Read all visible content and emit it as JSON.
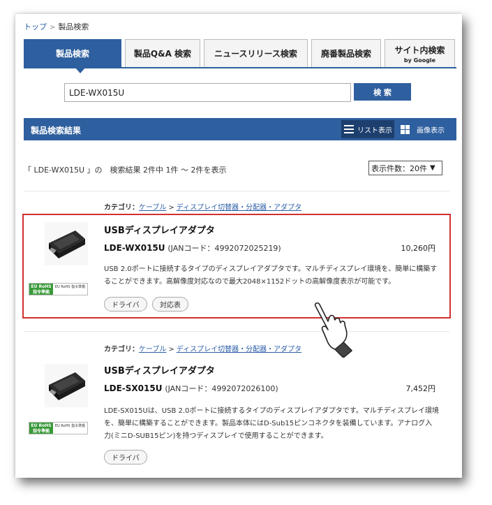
{
  "breadcrumb": {
    "home": "トップ",
    "separator": ">",
    "current": "製品検索"
  },
  "tabs": [
    {
      "label": "製品検索",
      "sub": "",
      "active": true
    },
    {
      "label": "製品Q&A 検索",
      "sub": ""
    },
    {
      "label": "ニュースリリース検索",
      "sub": ""
    },
    {
      "label": "廃番製品検索",
      "sub": ""
    },
    {
      "label": "サイト内検索",
      "sub": "by Google"
    }
  ],
  "search": {
    "value": "LDE-WX015U",
    "button": "検 索"
  },
  "results": {
    "title": "製品検索結果",
    "view_list": "リスト表示",
    "view_image": "画像表示",
    "summary": "「 LDE-WX015U 」の　検索結果 2件中 1件 ～ 2件を表示",
    "per_page": "表示件数：20件"
  },
  "products": [
    {
      "category_label": "カテゴリ：",
      "category_1": "ケーブル",
      "category_sep": ">",
      "category_2": "ディスプレイ切替器・分配器・アダプタ",
      "name": "USBディスプレイアダプタ",
      "model": "LDE-WX015U",
      "jan": "(JANコード：4992072025219)",
      "price": "10,260円",
      "desc": "USB 2.0ポートに接続するタイプのディスプレイアダプタです。マルチディスプレイ環境を、簡単に構築することができます。高解像度対応なので最大2048×1152ドットの高解像度表示が可能です。",
      "buttons": [
        "ドライバ",
        "対応表"
      ],
      "rohs_badge": "EU RoHS 指令準拠",
      "rohs_text": "EU RoHS 指令準拠"
    },
    {
      "category_label": "カテゴリ：",
      "category_1": "ケーブル",
      "category_sep": ">",
      "category_2": "ディスプレイ切替器・分配器・アダプタ",
      "name": "USBディスプレイアダプタ",
      "model": "LDE-SX015U",
      "jan": "(JANコード：4992072026100)",
      "price": "7,452円",
      "desc": "LDE-SX015Uは、USB 2.0ポートに接続するタイプのディスプレイアダプタです。マルチディスプレイ環境を、簡単に構築することができます。製品本体にはD-Sub15ピンコネクタを装備しています。アナログ入力(ミニD-SUB15ピン)を持つディスプレイで使用することができます。",
      "buttons": [
        "ドライバ"
      ],
      "rohs_badge": "EU RoHS 指令準拠",
      "rohs_text": "EU RoHS 指令準拠"
    }
  ],
  "colors": {
    "primary": "#2e5f9e",
    "highlight": "#d03030",
    "link": "#2a5ea8",
    "rohs": "#3a9a3a"
  }
}
